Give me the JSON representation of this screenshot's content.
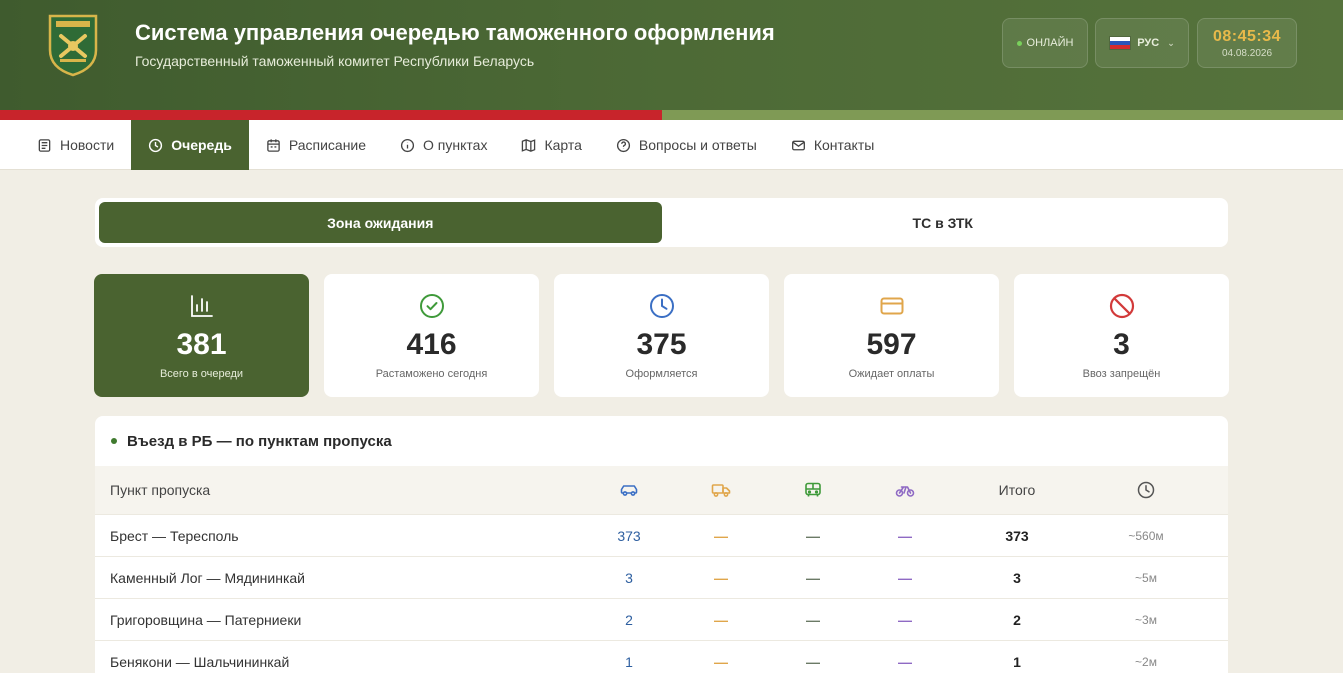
{
  "header": {
    "title": "Система управления очередью таможенного оформления",
    "subtitle": "Государственный таможенный комитет Республики Беларусь",
    "status": "ОНЛАЙН",
    "language": "РУС",
    "time": "08:45:34",
    "date": "04.08.2026",
    "emblem_icon": "customs-emblem-icon"
  },
  "nav": {
    "items": [
      {
        "label": "Новости",
        "icon": "newspaper-icon"
      },
      {
        "label": "Очередь",
        "icon": "clock-icon"
      },
      {
        "label": "Расписание",
        "icon": "calendar-icon"
      },
      {
        "label": "О пунктах",
        "icon": "info-icon"
      },
      {
        "label": "Карта",
        "icon": "map-icon"
      },
      {
        "label": "Вопросы и ответы",
        "icon": "question-icon"
      },
      {
        "label": "Контакты",
        "icon": "mail-icon"
      }
    ],
    "active": "Очередь"
  },
  "tabs": [
    {
      "label": "Зона ожидания"
    },
    {
      "label": "ТС в ЗТК"
    }
  ],
  "stats": [
    {
      "value": "381",
      "label": "Всего в очереди",
      "icon": "bar-chart-icon"
    },
    {
      "value": "416",
      "label": "Растаможено сегодня",
      "icon": "check-circle-icon",
      "color": "#3f9a3a"
    },
    {
      "value": "375",
      "label": "Оформляется",
      "icon": "clock-icon",
      "color": "#3b6fc4"
    },
    {
      "value": "597",
      "label": "Ожидает оплаты",
      "icon": "card-icon",
      "color": "#e0a64b"
    },
    {
      "value": "3",
      "label": "Ввоз запрещён",
      "icon": "forbidden-icon",
      "color": "#d23a3a"
    }
  ],
  "table": {
    "title": "Въезд в РБ — по пунктам пропуска",
    "headers": {
      "point": "Пункт пропуска",
      "car_icon": "car-icon",
      "truck_icon": "truck-icon",
      "bus_icon": "bus-icon",
      "bike_icon": "motorcycle-icon",
      "total": "Итого",
      "time_icon": "clock-icon"
    },
    "rows": [
      {
        "point": "Брест — Тересполь",
        "car": "373",
        "truck": "—",
        "bus": "—",
        "bike": "—",
        "total": "373",
        "time": "~560м"
      },
      {
        "point": "Каменный Лог — Мядининкай",
        "car": "3",
        "truck": "—",
        "bus": "—",
        "bike": "—",
        "total": "3",
        "time": "~5м"
      },
      {
        "point": "Григоровщина — Патерниеки",
        "car": "2",
        "truck": "—",
        "bus": "—",
        "bike": "—",
        "total": "2",
        "time": "~3м"
      },
      {
        "point": "Бенякони — Шальчининкай",
        "car": "1",
        "truck": "—",
        "bus": "—",
        "bike": "—",
        "total": "1",
        "time": "~2м"
      }
    ]
  },
  "colors": {
    "brand_green": "#4a6330",
    "header_green": "#3f5b2e",
    "flag_red": "#c8242b",
    "accent_gold": "#e8b94a"
  }
}
